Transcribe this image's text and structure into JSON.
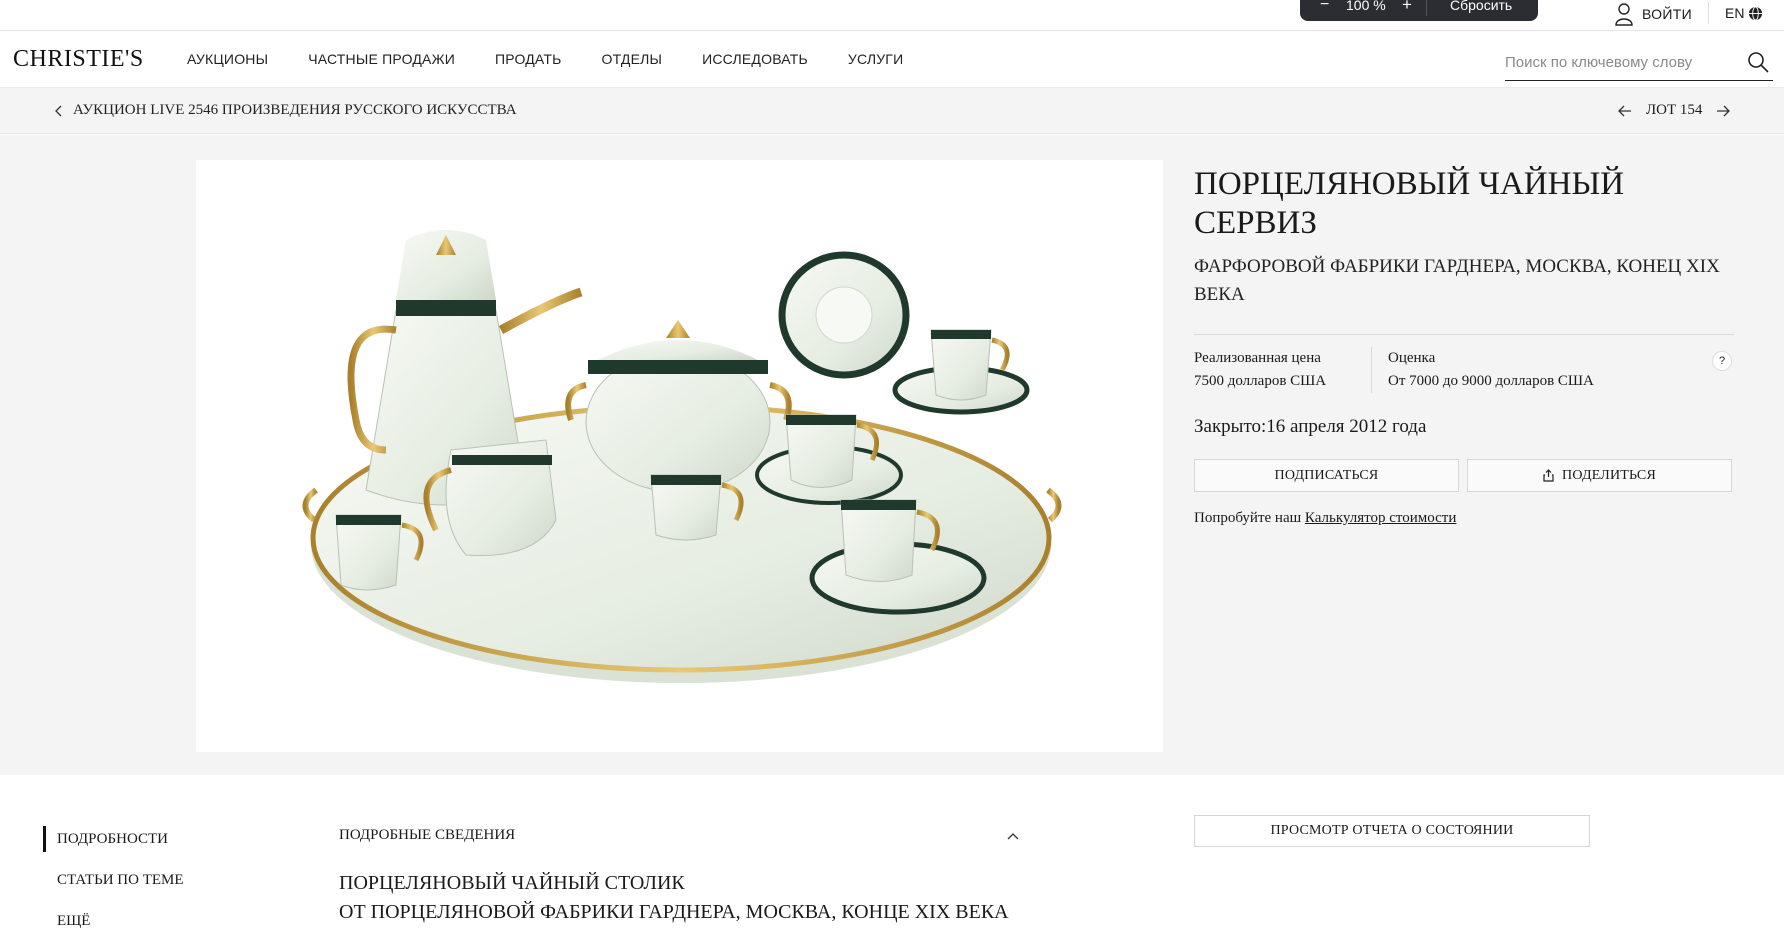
{
  "zoom": {
    "minus": "−",
    "value": "100 %",
    "plus": "+",
    "reset": "Сбросить"
  },
  "utility": {
    "login": "ВОЙТИ",
    "lang": "EN"
  },
  "brand": {
    "logo": "CHRISTIE'S"
  },
  "nav": {
    "items": [
      "АУКЦИОНЫ",
      "ЧАСТНЫЕ ПРОДАЖИ",
      "ПРОДАТЬ",
      "ОТДЕЛЫ",
      "ИССЛЕДОВАТЬ",
      "УСЛУГИ"
    ]
  },
  "search": {
    "placeholder": "Поиск по ключевому слову"
  },
  "breadcrumb": {
    "label": "АУКЦИОН LIVE 2546 ПРОИЗВЕДЕНИЯ РУССКОГО ИСКУССТВА"
  },
  "lot_nav": {
    "label": "ЛОТ 154"
  },
  "lot": {
    "title": "ПОРЦЕЛЯНОВЫЙ ЧАЙНЫЙ СЕРВИЗ",
    "subtitle": "ФАРФОРОВОЙ ФАБРИКИ ГАРДНЕРА, МОСКВА, КОНЕЦ XIX ВЕКА",
    "realized_label": "Реализованная цена",
    "realized_value": "7500 долларов США",
    "estimate_label": "Оценка",
    "estimate_value": "От 7000 до 9000 долларов США",
    "help": "?",
    "closed_label": "Закрыто:",
    "closed_date": "16 апреля 2012 года",
    "subscribe": "ПОДПИСАТЬСЯ",
    "share": "ПОДЕЛИТЬСЯ",
    "calc_prefix": "Попробуйте наш ",
    "calc_link": "Калькулятор стоимости"
  },
  "side_tabs": [
    "ПОДРОБНОСТИ",
    "СТАТЬИ ПО ТЕМЕ",
    "ЕЩЁ"
  ],
  "details": {
    "heading": "ПОДРОБНЫЕ СВЕДЕНИЯ",
    "line1": "ПОРЦЕЛЯНОВЫЙ ЧАЙНЫЙ СТОЛИК",
    "line2": "ОТ ПОРЦЕЛЯНОВОЙ ФАБРИКИ ГАРДНЕРА, МОСКВА, КОНЦЕ XIX ВЕКА"
  },
  "report_button": "ПРОСМОТР ОТЧЕТА О СОСТОЯНИИ",
  "colors": {
    "accent_dark": "#2b2d33",
    "gold": "#c9a24a",
    "porcelain": "#eef3ec",
    "band": "#1f3a2c"
  }
}
